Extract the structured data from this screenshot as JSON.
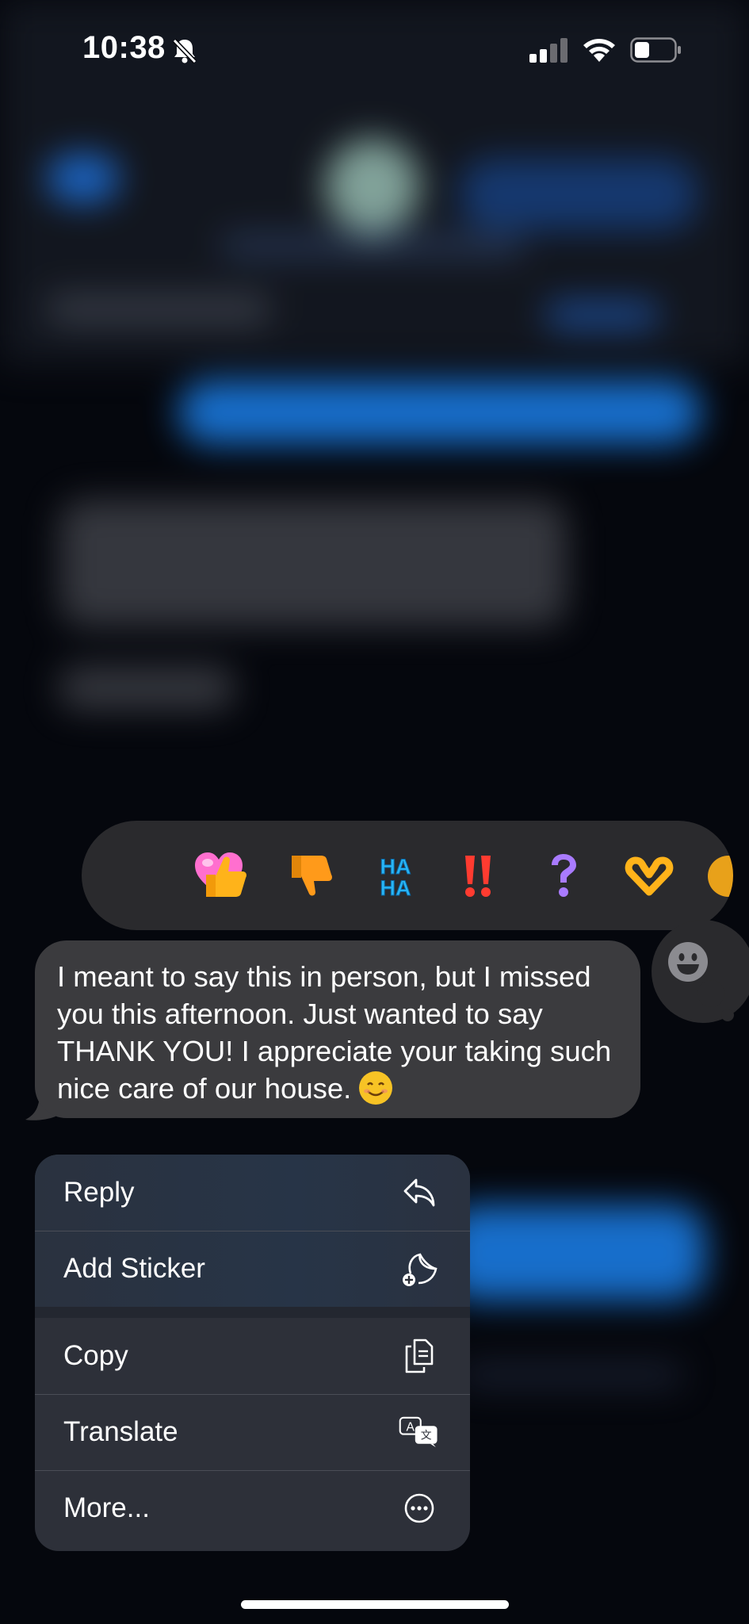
{
  "status_bar": {
    "time": "10:38",
    "icons": [
      "bell-slash-icon",
      "cellular-signal-icon",
      "wifi-icon",
      "battery-icon"
    ]
  },
  "tapbacks": [
    {
      "name": "heart",
      "icon": "heart-icon",
      "color": "#ff6fcf"
    },
    {
      "name": "thumbs-up",
      "icon": "thumbs-up-icon",
      "color": "#ffb31a"
    },
    {
      "name": "thumbs-down",
      "icon": "thumbs-down-icon",
      "color": "#ff9a1a"
    },
    {
      "name": "haha",
      "label": "HA HA",
      "color": "#29b6f6"
    },
    {
      "name": "exclamation",
      "label": "‼",
      "color": "#ff3b30"
    },
    {
      "name": "question",
      "label": "?",
      "color": "#a97bff"
    },
    {
      "name": "heart-hands",
      "icon": "heart-hands-icon",
      "color": "#ffb31a"
    }
  ],
  "message": {
    "text": "I meant to say this in person, but I missed you this afternoon. Just wanted to say THANK YOU!  I appreciate your taking such nice care of our house."
  },
  "menu": {
    "reply": "Reply",
    "add_sticker": "Add Sticker",
    "copy": "Copy",
    "translate": "Translate",
    "more": "More..."
  },
  "colors": {
    "menu_bg": "#2d3039",
    "bubble_bg": "#3b3b3e",
    "tapback_bg": "#2a2a2d"
  }
}
